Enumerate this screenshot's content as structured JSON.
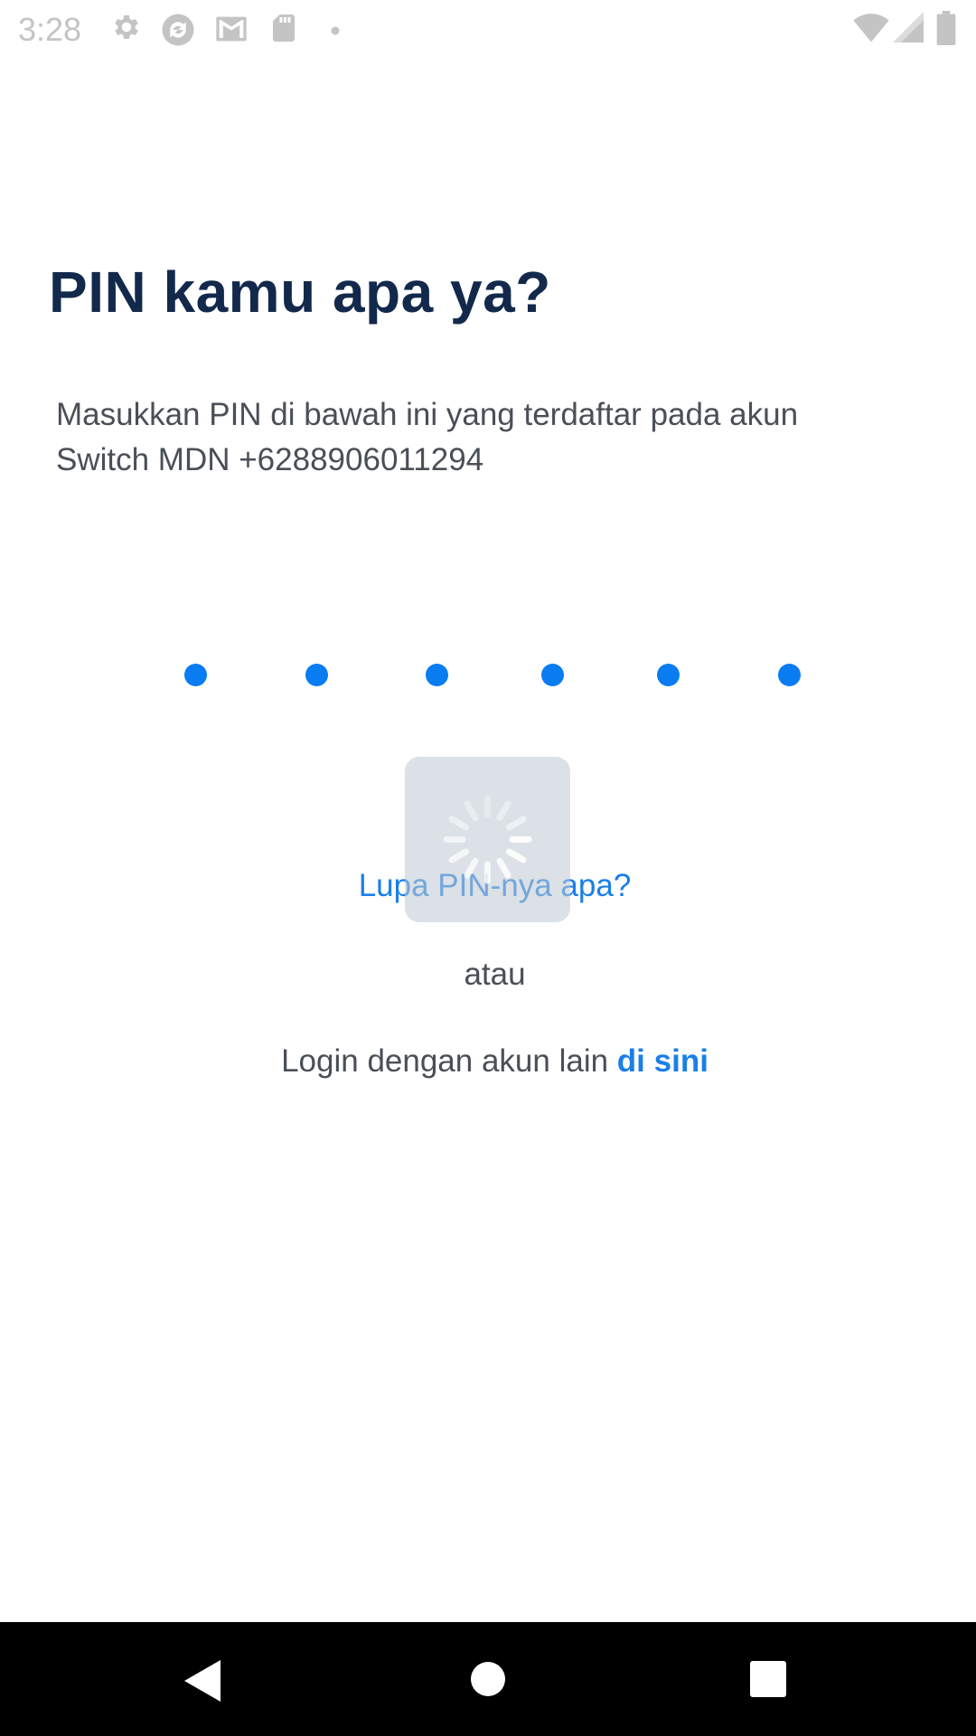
{
  "status_bar": {
    "time": "3:28",
    "left_icons": [
      "gear-icon",
      "sync-icon",
      "gmail-icon",
      "sd-card-icon",
      "dot-icon"
    ],
    "right_icons": [
      "wifi-icon",
      "signal-icon",
      "battery-icon"
    ]
  },
  "content": {
    "title": "PIN kamu apa ya?",
    "description_line1": "Masukkan PIN di bawah ini yang terdaftar pada akun",
    "description_line2": "Switch MDN +6288906011294",
    "pin_dots": 6,
    "forgot_pin_label": "Lupa PIN-nya apa?",
    "or_label": "atau",
    "login_prefix": "Login dengan akun lain ",
    "login_link_label": "di sini"
  },
  "loading": {
    "visible": true,
    "icon": "spinner-icon"
  },
  "nav_bar": {
    "buttons": [
      "back-icon",
      "home-icon",
      "recents-icon"
    ]
  },
  "colors": {
    "title": "#13294b",
    "body_text": "#4a4f57",
    "accent": "#1a7fe8",
    "pin_dot": "#0a7cf1",
    "nav_bar": "#000000"
  }
}
